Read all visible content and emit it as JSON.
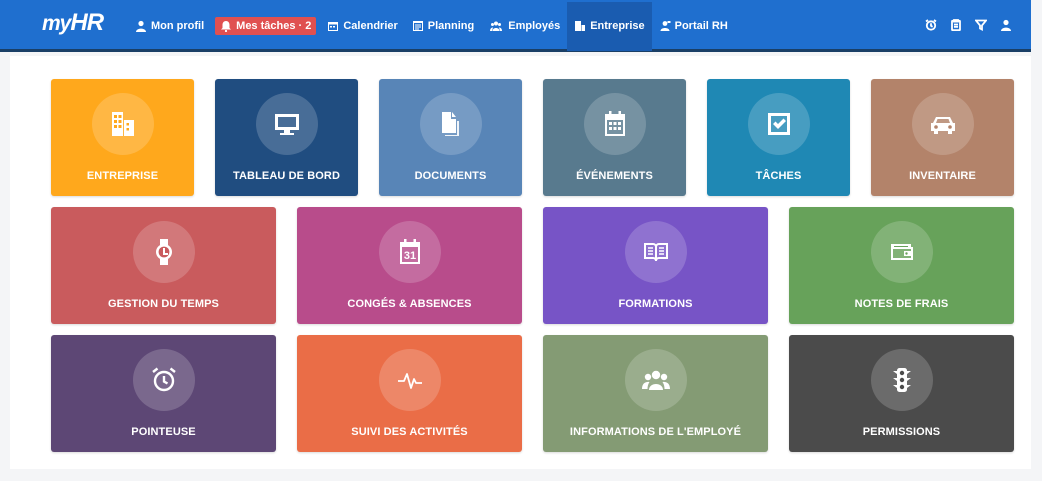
{
  "app": {
    "logo_my": "my",
    "logo_hr": "HR"
  },
  "nav": {
    "items": [
      {
        "label": "Mon profil",
        "icon": "user-icon"
      },
      {
        "label": "Mes tâches · 2",
        "icon": "bell-icon",
        "badge_color": "#e05050"
      },
      {
        "label": "Calendrier",
        "icon": "calendar-icon"
      },
      {
        "label": "Planning",
        "icon": "planning-icon"
      },
      {
        "label": "Employés",
        "icon": "users-icon"
      },
      {
        "label": "Entreprise",
        "icon": "building-icon",
        "active": true
      },
      {
        "label": "Portail RH",
        "icon": "portal-icon"
      }
    ],
    "right_icons": [
      "alarm-clock-icon",
      "clipboard-icon",
      "filter-icon",
      "user-icon"
    ]
  },
  "colors": {
    "topbar": "#1f6fcf",
    "topbar_border": "#1a3f66"
  },
  "tiles": [
    {
      "label": "ENTREPRISE",
      "icon": "building-icon",
      "color": "#ffa81c"
    },
    {
      "label": "TABLEAU DE BORD",
      "icon": "monitor-icon",
      "color": "#204d80"
    },
    {
      "label": "DOCUMENTS",
      "icon": "documents-icon",
      "color": "#5885b7"
    },
    {
      "label": "ÉVÉNEMENTS",
      "icon": "calendar-icon",
      "color": "#587a8e"
    },
    {
      "label": "TÂCHES",
      "icon": "checkbox-icon",
      "color": "#1f88b4"
    },
    {
      "label": "INVENTAIRE",
      "icon": "car-icon",
      "color": "#b3836a"
    },
    {
      "label": "GESTION DU TEMPS",
      "icon": "watch-icon",
      "color": "#c95b5d"
    },
    {
      "label": "CONGÉS & ABSENCES",
      "icon": "calendar-31-icon",
      "color": "#b84c8b"
    },
    {
      "label": "FORMATIONS",
      "icon": "book-icon",
      "color": "#7754c6"
    },
    {
      "label": "NOTES DE FRAIS",
      "icon": "wallet-icon",
      "color": "#67a25a"
    },
    {
      "label": "POINTEUSE",
      "icon": "alarm-clock-icon",
      "color": "#5d4775"
    },
    {
      "label": "SUIVI DES ACTIVITÉS",
      "icon": "activity-icon",
      "color": "#ea6d47"
    },
    {
      "label": "INFORMATIONS DE L'EMPLOYÉ",
      "icon": "users-icon",
      "color": "#849b74"
    },
    {
      "label": "PERMISSIONS",
      "icon": "traffic-light-icon",
      "color": "#4b4b4b"
    }
  ]
}
